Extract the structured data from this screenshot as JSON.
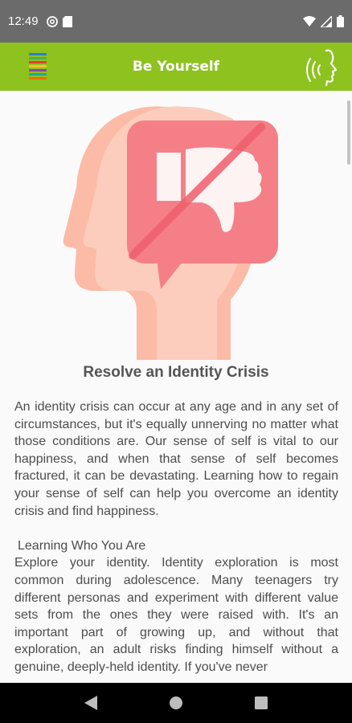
{
  "status_bar": {
    "time": "12:49",
    "left_icons": [
      "at-sign-icon",
      "sd-card-icon"
    ],
    "right_icons": [
      "wifi-icon",
      "signal-icon",
      "battery-icon"
    ]
  },
  "app_bar": {
    "title": "Be Yourself",
    "background_color": "#8dc21f",
    "menu_icon": "striped-menu-icon",
    "action_icon": "speaking-head-icon"
  },
  "article": {
    "hero_icon": "head-with-crossed-thumbs-down-icon",
    "title": "Resolve an Identity Crisis",
    "intro": "An identity crisis can occur at any age and in any set of circumstances, but it's equally unnerving no matter what those conditions are. Our sense of self is vital to our happiness, and when that sense of self becomes fractured, it can be devastating. Learning how to regain your sense of self can help you overcome an identity crisis and find happiness.",
    "section_heading": "Learning Who You Are",
    "section_body": "Explore your identity. Identity exploration is most common during adolescence. Many teenagers try different personas and experiment with different value sets from the ones they were raised with. It's an important part of growing up, and without that exploration, an adult risks finding himself without a genuine, deeply-held identity. If you've never"
  },
  "nav_bar": {
    "back_icon": "back-triangle-icon",
    "home_icon": "home-circle-icon",
    "recents_icon": "recents-square-icon"
  }
}
